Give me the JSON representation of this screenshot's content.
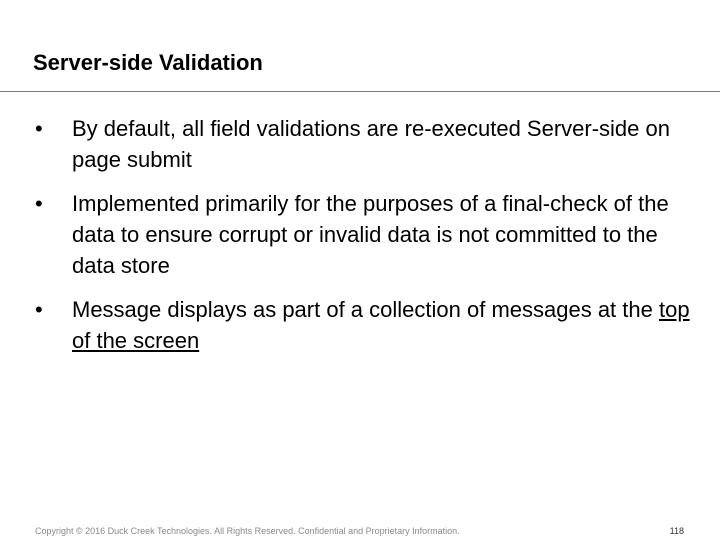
{
  "slide": {
    "title": "Server-side Validation",
    "accent_color": "#1ba3b3",
    "bullet_symbol": "•",
    "bullets": [
      {
        "text": "By default, all field validations are re-executed Server-side on page submit"
      },
      {
        "text": "Implemented primarily for the purposes of a final-check of the data to ensure corrupt or invalid data is not committed to the data store"
      },
      {
        "text": "Message displays as part of a collection of messages at the ",
        "underlined_text": "top of the screen"
      }
    ]
  },
  "footer": {
    "copyright": "Copyright © 2016 Duck Creek Technologies. All Rights Reserved. Confidential and Proprietary Information.",
    "page_number": "118"
  }
}
